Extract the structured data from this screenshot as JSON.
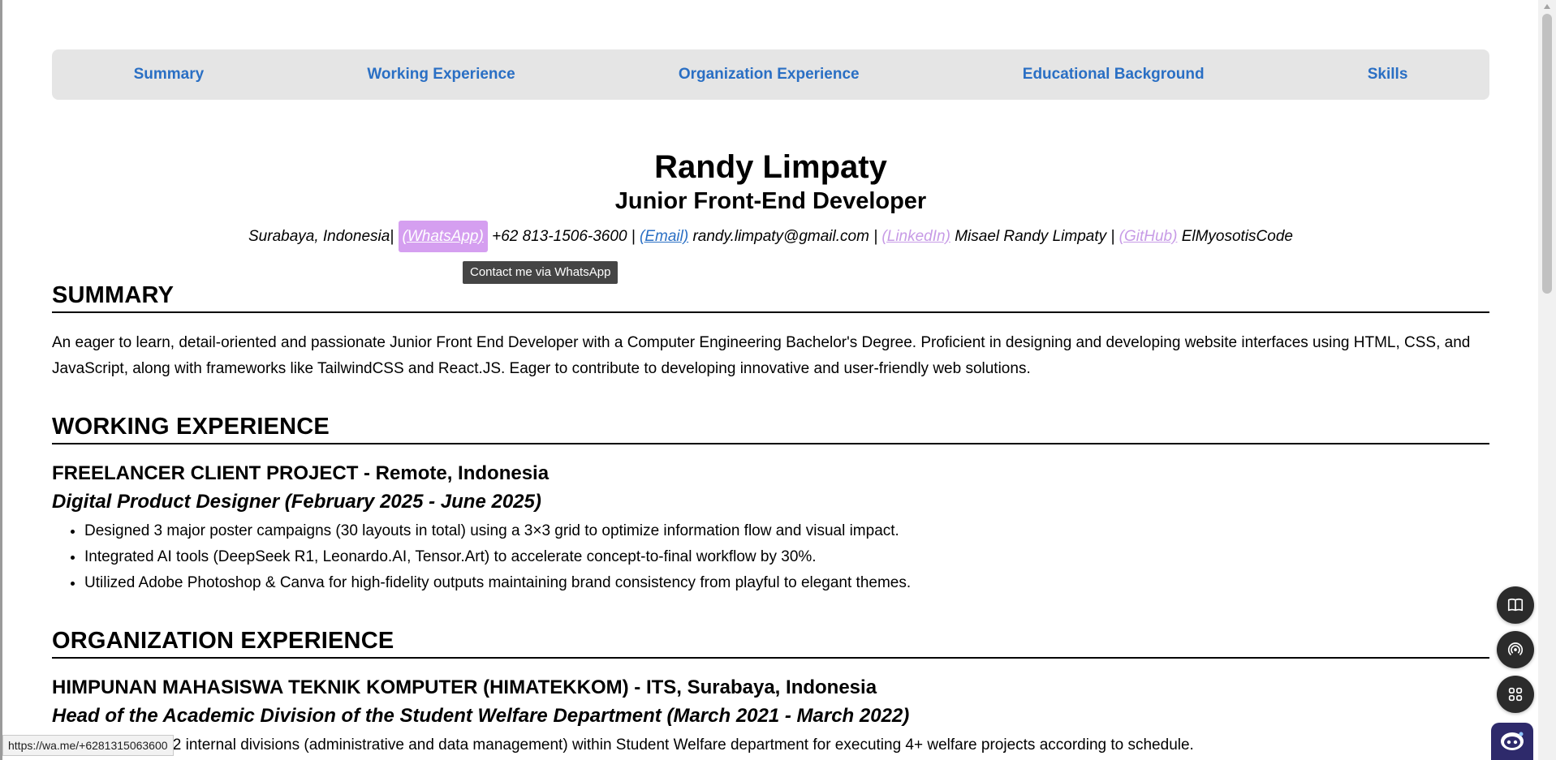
{
  "nav": {
    "items": [
      {
        "label": "Summary"
      },
      {
        "label": "Working Experience"
      },
      {
        "label": "Organization Experience"
      },
      {
        "label": "Educational Background"
      },
      {
        "label": "Skills"
      }
    ]
  },
  "header": {
    "name": "Randy Limpaty",
    "role": "Junior Front-End Developer",
    "location": "Surabaya, Indonesia",
    "sep": "|",
    "whatsapp_label": "(WhatsApp)",
    "phone": "+62 813-1506-3600",
    "email_label": "(Email)",
    "email": "randy.limpaty@gmail.com",
    "linkedin_label": "(LinkedIn)",
    "linkedin": "Misael Randy Limpaty",
    "github_label": "(GitHub)",
    "github": "ElMyosotisCode"
  },
  "tooltip": "Contact me via WhatsApp",
  "summary": {
    "title": "SUMMARY",
    "text": "An eager to learn, detail-oriented and passionate Junior Front End Developer with a Computer Engineering Bachelor's Degree. Proficient in designing and developing website interfaces using HTML, CSS, and JavaScript, along with frameworks like TailwindCSS and React.JS. Eager to contribute to developing innovative and user-friendly web solutions."
  },
  "working": {
    "title": "WORKING EXPERIENCE",
    "org": "FREELANCER CLIENT PROJECT - Remote, Indonesia",
    "position": "Digital Product Designer (February 2025 - June 2025)",
    "bullets": [
      "Designed 3 major poster campaigns (30 layouts in total) using a 3×3 grid to optimize information flow and visual impact.",
      "Integrated AI tools (DeepSeek R1, Leonardo.AI, Tensor.Art) to accelerate concept-to-final workflow by 30%.",
      "Utilized Adobe Photoshop & Canva for high-fidelity outputs maintaining brand consistency from playful to elegant themes."
    ]
  },
  "organization": {
    "title": "ORGANIZATION EXPERIENCE",
    "org": "HIMPUNAN MAHASISWA TEKNIK KOMPUTER (HIMATEKKOM) - ITS, Surabaya, Indonesia",
    "position": "Head of the Academic Division of the Student Welfare Department (March 2021 - March 2022)",
    "bullets": [
      "Coordinated 2 internal divisions (administrative and data management) within Student Welfare department for executing 4+ welfare projects according to schedule."
    ]
  },
  "status_url": "https://wa.me/+6281315063600",
  "floating": {
    "icons": [
      "book-icon",
      "broadcast-icon",
      "apps-icon",
      "bot-icon"
    ]
  },
  "colors": {
    "link": "#2a6fc4",
    "whatsapp_bg": "#d59ff0",
    "muted_purple": "#c79be6",
    "nav_bg": "#e5e5e5"
  }
}
